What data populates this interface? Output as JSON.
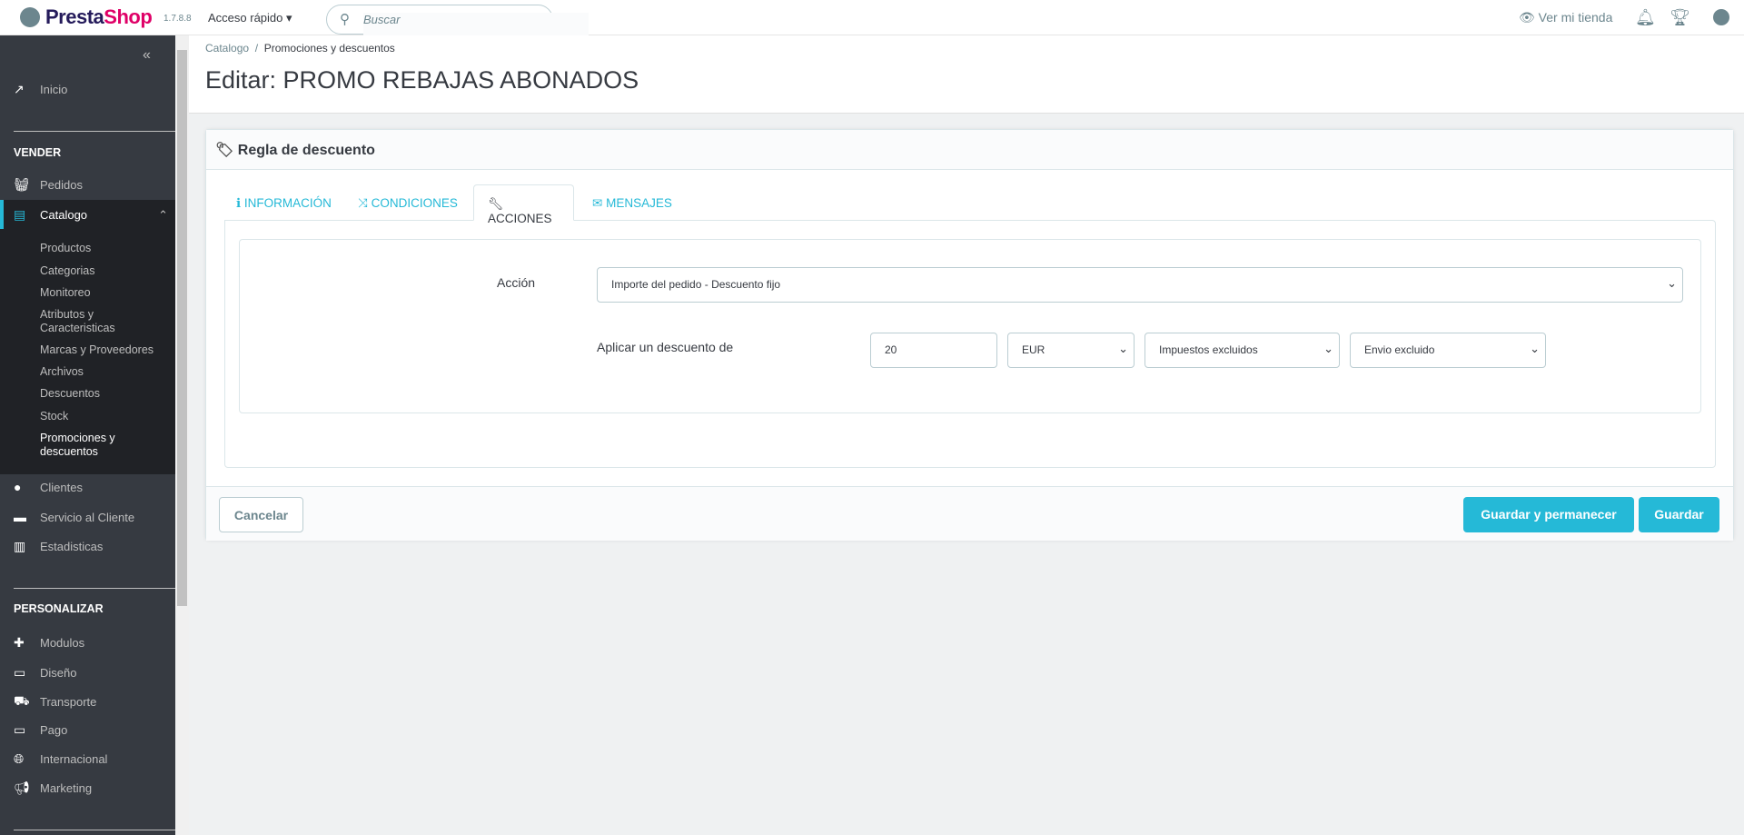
{
  "topbar": {
    "brand_a": "Presta",
    "brand_b": "Shop",
    "version": "1.7.8.8",
    "quick_access": "Acceso rápido",
    "search_placeholder": "Buscar",
    "view_store": "Ver mi tienda"
  },
  "sidebar": {
    "inicio": "Inicio",
    "sections": [
      {
        "title": "VENDER"
      },
      {
        "title": "PERSONALIZAR"
      }
    ],
    "vender": [
      "Pedidos",
      "Catalogo",
      "Clientes",
      "Servicio al Cliente",
      "Estadisticas"
    ],
    "catalogo_sub": [
      "Productos",
      "Categorias",
      "Monitoreo",
      "Atributos y Caracteristicas",
      "Marcas y Proveedores",
      "Archivos",
      "Descuentos",
      "Stock",
      "Promociones y descuentos"
    ],
    "personalizar": [
      "Modulos",
      "Diseño",
      "Transporte",
      "Pago",
      "Internacional",
      "Marketing"
    ]
  },
  "breadcrumb": [
    "Catalogo",
    "Promociones y descuentos"
  ],
  "page_title": "Editar: PROMO REBAJAS ABONADOS",
  "panel": {
    "title": "Regla de descuento",
    "tabs": [
      "INFORMACIÓN",
      "CONDICIONES",
      "ACCIONES",
      "MENSAJES"
    ],
    "active_tab": "ACCIONES",
    "action_label": "Acción",
    "action_value": "Importe del pedido - Descuento fijo",
    "apply_label": "Aplicar un descuento de",
    "amount": "20",
    "currency": "EUR",
    "tax": "Impuestos excluidos",
    "shipping": "Envio excluido",
    "cancel": "Cancelar",
    "save_stay": "Guardar y permanecer",
    "save": "Guardar"
  },
  "colors": {
    "accent": "#25b9d7",
    "sidebar": "#363a41",
    "sidebar_dark": "#202226"
  }
}
